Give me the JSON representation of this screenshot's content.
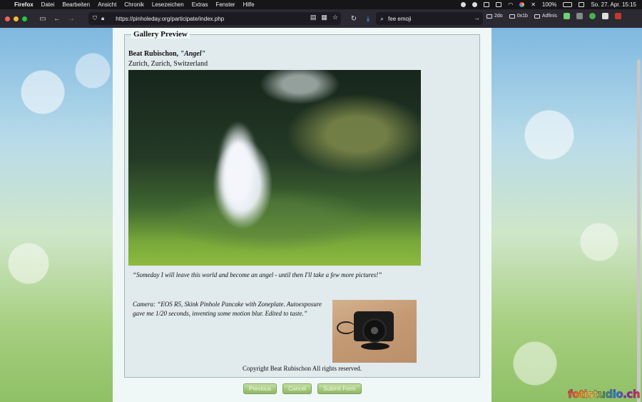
{
  "menubar": {
    "app": "Firefox",
    "menus": [
      "Datei",
      "Bearbeiten",
      "Ansicht",
      "Chronik",
      "Lesezeichen",
      "Extras",
      "Fenster",
      "Hilfe"
    ],
    "battery": "100%",
    "datetime": "So. 27. Apr.  15:15"
  },
  "browser": {
    "url": "https://pinholeday.org/participate/index.php",
    "search_query": "fee emoji",
    "bookmarks": [
      "2do",
      "0x1b",
      "Adfinis"
    ]
  },
  "page": {
    "legend": "Gallery Preview",
    "photographer": "Beat Rubischon,",
    "photo_title": "\"Angel\"",
    "location": "Zurich, Zurich, Switzerland",
    "quote": "“Someday I will leave this world and become an angel - until then I'll take a few more pictures!”",
    "camera_text": "Camera: “EOS R5, Skink Pinhole Pancake with Zoneplate. Autoexposure gave me 1/20 seconds, inventing some motion blur. Edited to taste.”",
    "copyright": "Copyright Beat Rubischon All rights reserved.",
    "buttons": {
      "previous": "Previous",
      "cancel": "Cancel",
      "submit": "Submit Form"
    }
  },
  "watermark": "fotistudio.ch"
}
